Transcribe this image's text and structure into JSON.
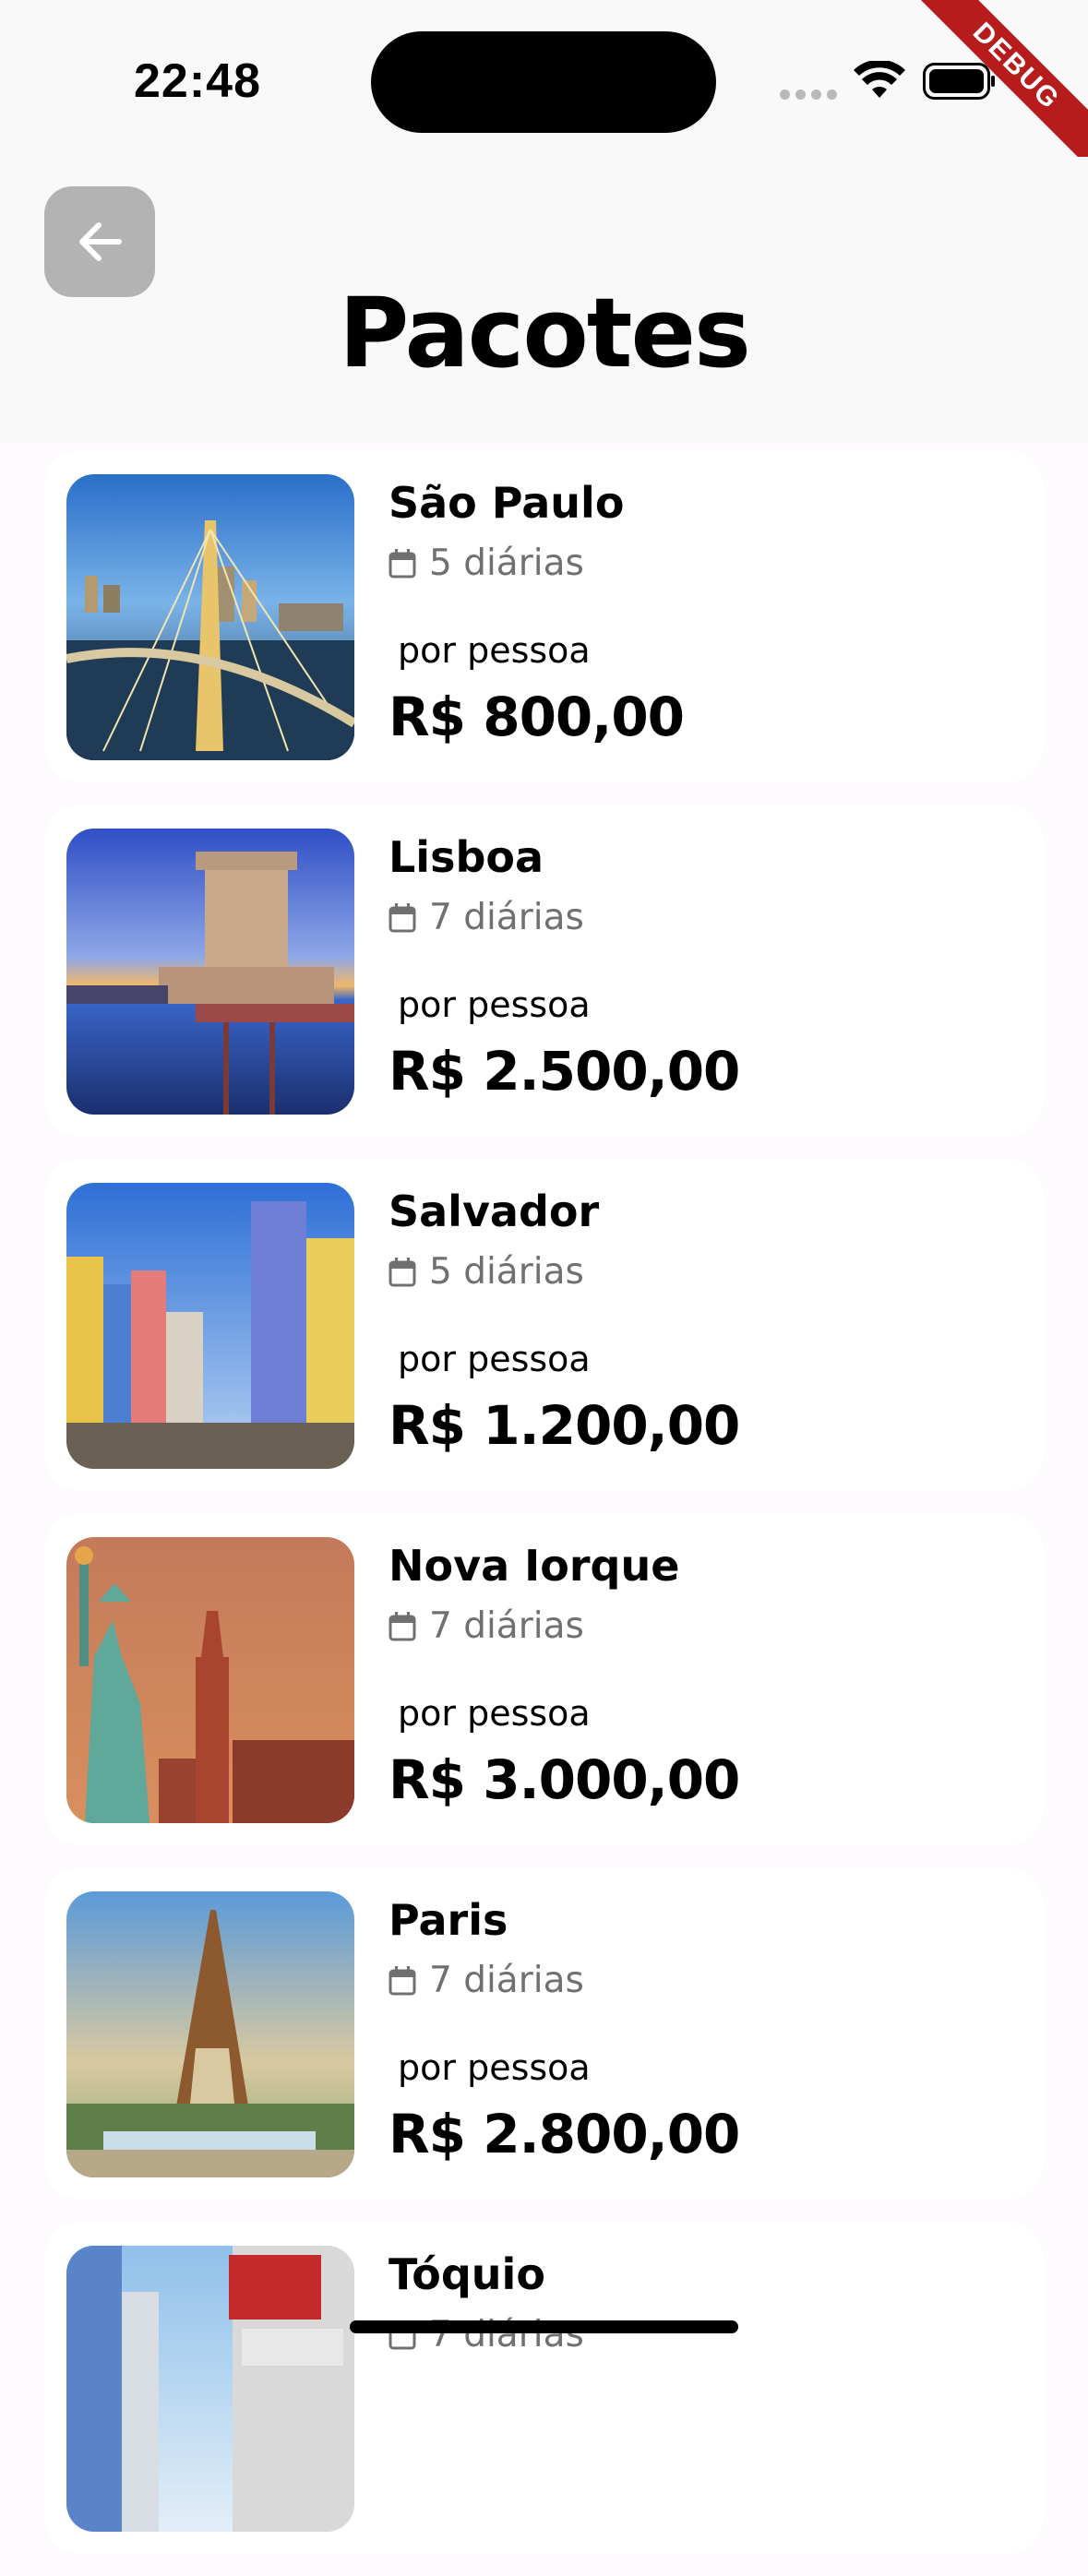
{
  "status_bar": {
    "time": "22:48"
  },
  "debug_banner": "DEBUG",
  "header": {
    "title": "Pacotes"
  },
  "labels": {
    "per_person": "por pessoa"
  },
  "packages": [
    {
      "city": "São Paulo",
      "nights": "5 diárias",
      "price": "R$ 800,00"
    },
    {
      "city": "Lisboa",
      "nights": "7 diárias",
      "price": "R$ 2.500,00"
    },
    {
      "city": "Salvador",
      "nights": "5 diárias",
      "price": "R$ 1.200,00"
    },
    {
      "city": "Nova Iorque",
      "nights": "7 diárias",
      "price": "R$ 3.000,00"
    },
    {
      "city": "Paris",
      "nights": "7 diárias",
      "price": "R$ 2.800,00"
    },
    {
      "city": "Tóquio",
      "nights": "7 diárias",
      "price": ""
    }
  ],
  "colors": {
    "background": "#fefbff",
    "header_background": "#f9f9f9",
    "card": "#ffffff",
    "back_button": "#b3b3b3",
    "debug_ribbon": "#b71c1c",
    "muted_text": "#707070"
  },
  "icons": [
    "arrow-left-icon",
    "calendar-icon",
    "wifi-icon",
    "battery-icon"
  ]
}
